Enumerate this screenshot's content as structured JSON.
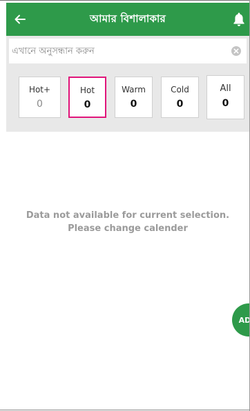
{
  "app_bar": {
    "title": "আমার বিশালাকার",
    "back_icon": "arrow-left-icon",
    "notification_icon": "bell-icon",
    "color": "#2e9a4a"
  },
  "search": {
    "placeholder": "এখানে অনুসন্ধান করুন",
    "value": "",
    "clear_icon": "clear-circle-icon"
  },
  "categories": [
    {
      "label": "Hot+",
      "count": "0",
      "selected": false
    },
    {
      "label": "Hot",
      "count": "0",
      "selected": true
    },
    {
      "label": "Warm",
      "count": "0",
      "selected": false
    },
    {
      "label": "Cold",
      "count": "0",
      "selected": false
    },
    {
      "label": "All",
      "count": "0",
      "selected": false
    }
  ],
  "selected_color": "#e0147a",
  "empty_state": {
    "line1": "Data not available for current selection.",
    "line2": "Please change calender"
  },
  "fab": {
    "label": "ADD"
  }
}
